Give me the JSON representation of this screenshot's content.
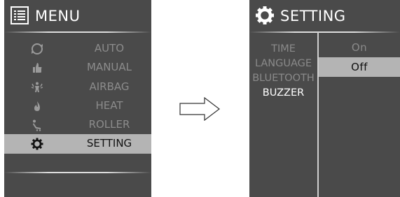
{
  "menu": {
    "title": "MENU",
    "items": [
      {
        "label": "AUTO",
        "icon": "auto-cycle-icon"
      },
      {
        "label": "MANUAL",
        "icon": "hand-icon"
      },
      {
        "label": "AIRBAG",
        "icon": "airbag-person-icon"
      },
      {
        "label": "HEAT",
        "icon": "flame-icon"
      },
      {
        "label": "ROLLER",
        "icon": "roller-icon"
      },
      {
        "label": "SETTING",
        "icon": "gear-icon",
        "selected": true
      }
    ]
  },
  "setting": {
    "title": "SETTING",
    "options": [
      "TIME",
      "LANGUAGE",
      "BLUETOOTH",
      "BUZZER"
    ],
    "active_option": "BUZZER",
    "values": [
      "On",
      "Off"
    ],
    "selected_value": "Off"
  },
  "colors": {
    "panel_bg": "#4a4a4a",
    "highlight_bg": "#b4b4b4",
    "dim_text": "#8c8c8c",
    "bright_text": "#ffffff"
  }
}
